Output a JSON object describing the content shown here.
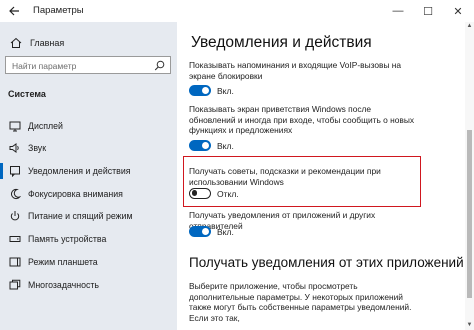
{
  "window": {
    "title": "Параметры",
    "controls": {
      "minimize": "—",
      "maximize": "☐",
      "close": "✕"
    }
  },
  "sidebar": {
    "home_label": "Главная",
    "search_placeholder": "Найти параметр",
    "section_title": "Система",
    "items": [
      {
        "label": "Дисплей",
        "icon": "display-icon",
        "active": false
      },
      {
        "label": "Звук",
        "icon": "speaker-icon",
        "active": false
      },
      {
        "label": "Уведомления и действия",
        "icon": "notifications-icon",
        "active": true
      },
      {
        "label": "Фокусировка внимания",
        "icon": "moon-icon",
        "active": false
      },
      {
        "label": "Питание и спящий режим",
        "icon": "power-icon",
        "active": false
      },
      {
        "label": "Память устройства",
        "icon": "storage-icon",
        "active": false
      },
      {
        "label": "Режим планшета",
        "icon": "tablet-icon",
        "active": false
      },
      {
        "label": "Многозадачность",
        "icon": "multitasking-icon",
        "active": false
      }
    ]
  },
  "main": {
    "heading": "Уведомления и действия",
    "settings": [
      {
        "text": "Показывать напоминания и входящие VoIP-вызовы на экране блокировки",
        "state": "on",
        "state_label": "Вкл."
      },
      {
        "text": "Показывать экран приветствия Windows после обновлений и иногда при входе, чтобы сообщить о новых функциях и предложениях",
        "state": "on",
        "state_label": "Вкл."
      },
      {
        "text": "Получать советы, подсказки и рекомендации при использовании Windows",
        "state": "off",
        "state_label": "Откл."
      },
      {
        "text": "Получать уведомления от приложений и других отправителей",
        "state": "on",
        "state_label": "Вкл."
      }
    ],
    "subheading": "Получать уведомления от этих приложений",
    "subtext": "Выберите приложение, чтобы просмотреть дополнительные параметры. У некоторых приложений также могут быть собственные параметры уведомлений. Если это так,"
  },
  "colors": {
    "accent": "#0067c0",
    "highlight_border": "#d0171f",
    "sidebar_bg": "#e6eaf0"
  }
}
